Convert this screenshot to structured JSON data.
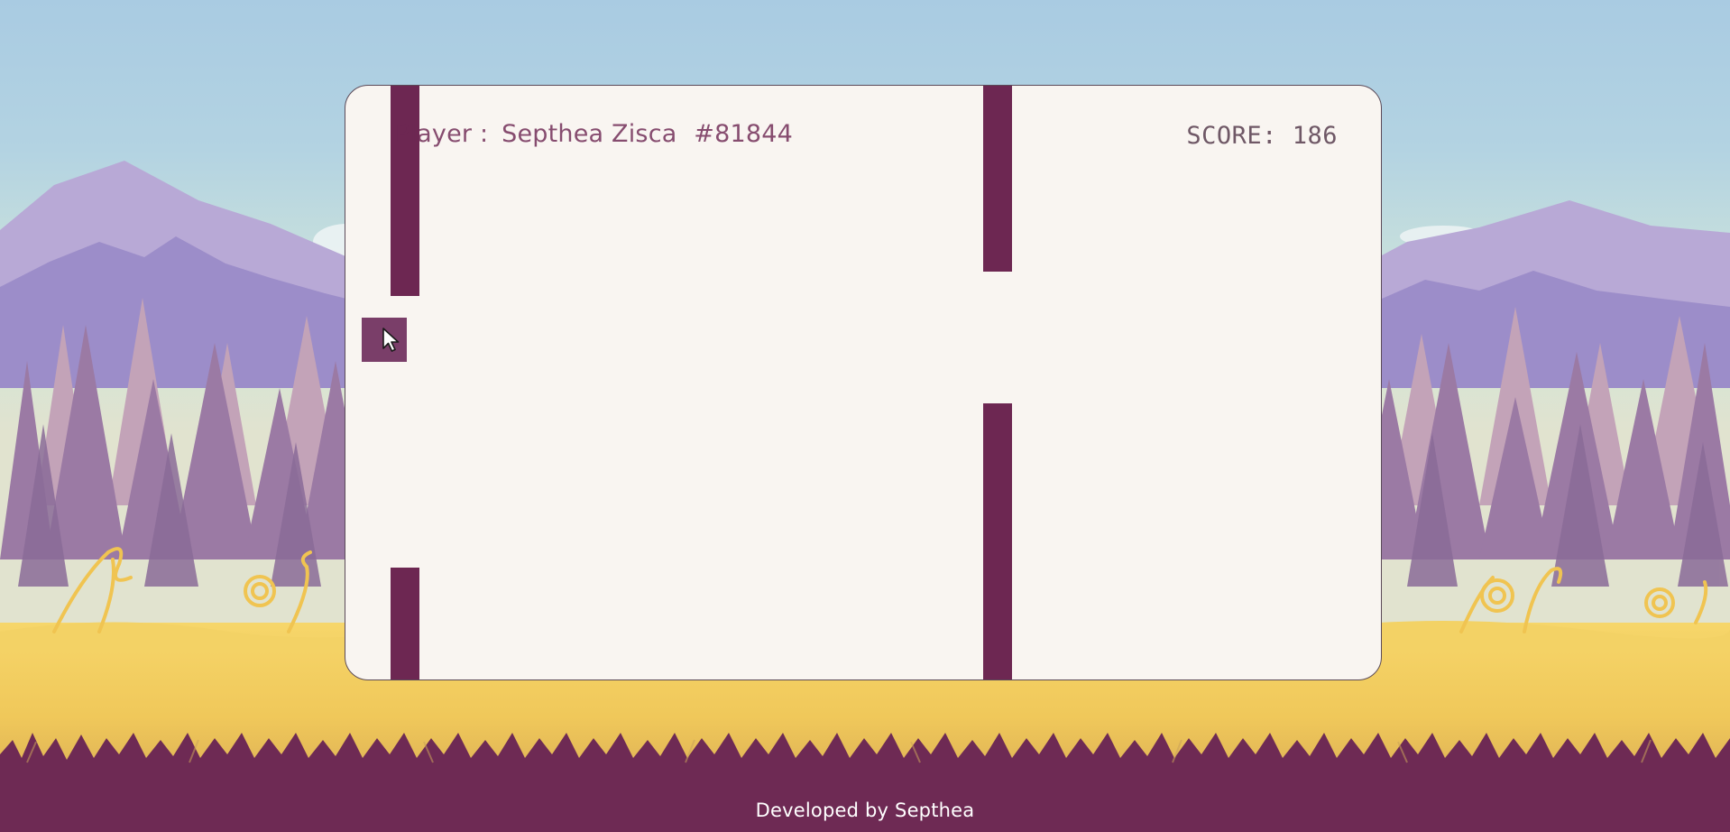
{
  "game": {
    "player_prefix": "Player :",
    "player_name": "Septhea Zisca",
    "player_id": "#81844",
    "score_label": "SCORE:",
    "score_value": "186"
  },
  "footer": {
    "credit": "Developed by Septhea"
  },
  "colors": {
    "pipe": "#6d2752",
    "player_block": "#7a3e69",
    "board_background": "#f9f5f1",
    "footer_background": "#6e2a54"
  },
  "icons": {
    "cursor": "mouse-pointer-icon"
  }
}
